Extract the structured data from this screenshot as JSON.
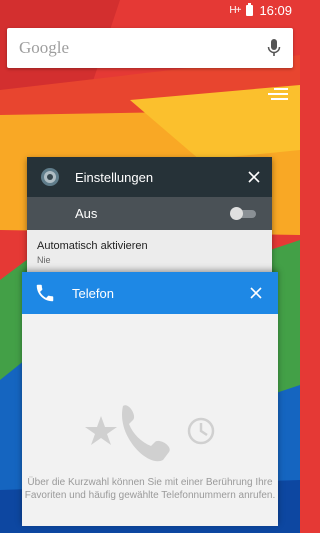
{
  "status_bar": {
    "signal": "H+",
    "time": "16:09"
  },
  "search": {
    "logo": "Google"
  },
  "settings_card": {
    "title": "Einstellungen",
    "toggle_label": "Aus",
    "row_title": "Automatisch aktivieren",
    "row_sub": "Nie"
  },
  "phone_card": {
    "title": "Telefon",
    "description": "Über die Kurzwahl können Sie mit einer Berührung Ihre Favoriten und häufig gewählte Telefonnummern anrufen."
  },
  "colors": {
    "settings_header": "#263238",
    "phone_header": "#1e88e5",
    "wallpaper_red": "#e53935",
    "wallpaper_yellow": "#f9a825"
  }
}
